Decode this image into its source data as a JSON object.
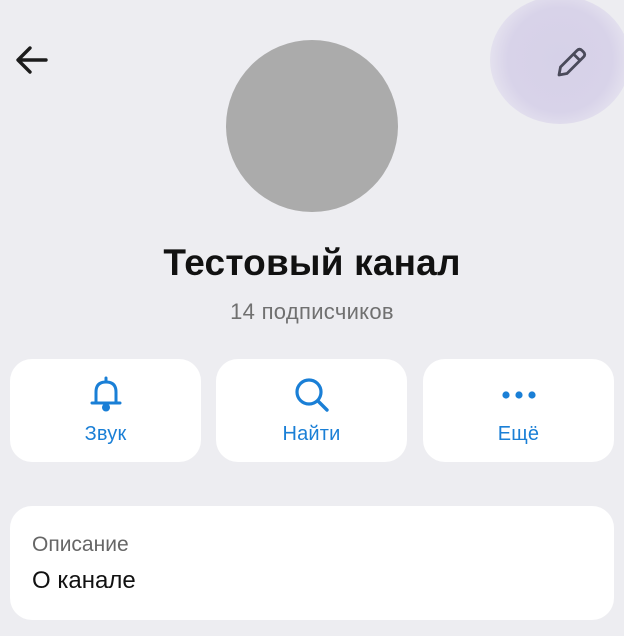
{
  "header": {
    "back_icon": "arrow-left-icon",
    "edit_icon": "pencil-icon"
  },
  "channel": {
    "title": "Тестовый канал",
    "subscribers": "14 подписчиков"
  },
  "actions": [
    {
      "label": "Звук",
      "icon": "bell-icon"
    },
    {
      "label": "Найти",
      "icon": "search-icon"
    },
    {
      "label": "Ещё",
      "icon": "more-dots-icon"
    }
  ],
  "description": {
    "label": "Описание",
    "value": "О канале"
  },
  "colors": {
    "background": "#ededf1",
    "accent": "#1a7fd6",
    "avatar": "#ababab",
    "edit_highlight": "#d6d1e8"
  }
}
